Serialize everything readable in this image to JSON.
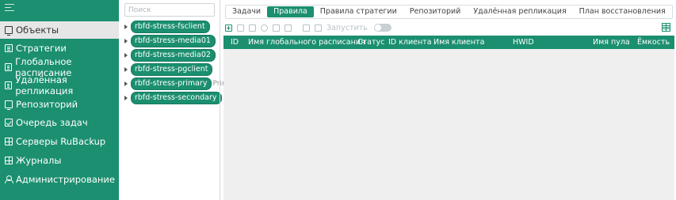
{
  "sidebar": {
    "toggle_icon": "menu-icon",
    "items": [
      {
        "label": "Объекты",
        "icon": "monitor-icon",
        "active": true
      },
      {
        "label": "Стратегии",
        "icon": "document-icon"
      },
      {
        "label": "Глобальное расписание",
        "icon": "document-icon"
      },
      {
        "label": "Удалённая репликация",
        "icon": "document-icon"
      },
      {
        "label": "Репозиторий",
        "icon": "storage-icon"
      },
      {
        "label": "Очередь задач",
        "icon": "checklist-icon"
      },
      {
        "label": "Серверы RuBackup",
        "icon": "server-icon"
      },
      {
        "label": "Журналы",
        "icon": "log-icon"
      },
      {
        "label": "Администрирование",
        "icon": "users-icon"
      }
    ]
  },
  "tree": {
    "search_placeholder": "Поиск",
    "nodes": [
      {
        "label": "rbfd-stress-fsclient"
      },
      {
        "label": "rbfd-stress-media01"
      },
      {
        "label": "rbfd-stress-media02"
      },
      {
        "label": "rbfd-stress-pgclient"
      },
      {
        "label": "rbfd-stress-primary",
        "extra": "Prim"
      },
      {
        "label": "rbfd-stress-secondary"
      }
    ]
  },
  "main": {
    "tabs": [
      {
        "label": "Задачи"
      },
      {
        "label": "Правила",
        "active": true
      },
      {
        "label": "Правила стратегии"
      },
      {
        "label": "Репозиторий"
      },
      {
        "label": "Удалённая репликация"
      },
      {
        "label": "План восстановления"
      }
    ],
    "toolbar": {
      "run_label": "Запустить"
    },
    "table": {
      "columns": [
        "ID",
        "Имя глобального расписания",
        "Статус",
        "ID клиента",
        "Имя клиента",
        "HWID",
        "Имя пула",
        "Ёмкость"
      ],
      "rows": []
    }
  },
  "colors": {
    "brand": "#1b8f70",
    "active_item_bg": "#e6e6e6",
    "table_bg": "#efefef"
  }
}
